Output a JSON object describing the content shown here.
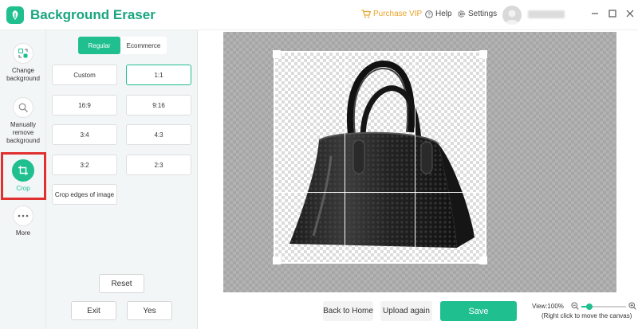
{
  "app": {
    "title": "Background Eraser"
  },
  "header": {
    "purchase_vip": "Purchase VIP",
    "help": "Help",
    "settings": "Settings"
  },
  "tools": [
    {
      "label": "Change background",
      "icon": "change-background-icon",
      "active": false
    },
    {
      "label": "Manually remove background",
      "icon": "manual-remove-icon",
      "active": false
    },
    {
      "label": "Crop",
      "icon": "crop-icon",
      "active": true
    },
    {
      "label": "More",
      "icon": "more-dots-icon",
      "active": false
    }
  ],
  "crop_panel": {
    "tabs": [
      {
        "label": "Regular",
        "selected": true
      },
      {
        "label": "Ecommerce",
        "selected": false
      }
    ],
    "ratios": [
      "Custom",
      "1:1",
      "16:9",
      "9:16",
      "3:4",
      "4:3",
      "3:2",
      "2:3",
      "Crop edges of image"
    ],
    "selected_ratio": "1:1",
    "reset": "Reset",
    "exit": "Exit",
    "yes": "Yes"
  },
  "bottom": {
    "back_home": "Back to Home",
    "upload_again": "Upload again",
    "save": "Save",
    "view_zoom": "View:100%",
    "hint": "(Right click to move the canvas)",
    "zoom_fraction": 0.18
  },
  "colors": {
    "accent": "#1fbf8f",
    "vip": "#e8a32a",
    "highlight": "#e03030"
  }
}
